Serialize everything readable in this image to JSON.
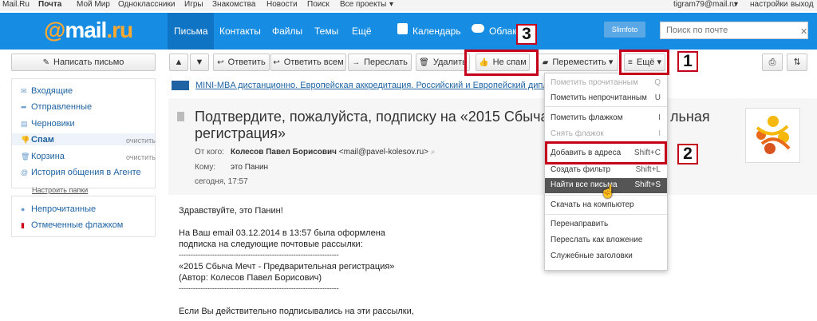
{
  "portal": {
    "links": [
      "Mail.Ru",
      "Почта",
      "Мой Мир",
      "Одноклассники",
      "Игры",
      "Знакомства",
      "Новости",
      "Поиск",
      "Все проекты"
    ],
    "user": "tigram79@mail.ru",
    "settings": "настройки",
    "logout": "выход"
  },
  "header": {
    "logo_at": "@",
    "logo_text": "mail",
    "logo_ru": ".ru",
    "nav": [
      "Письма",
      "Контакты",
      "Файлы",
      "Темы",
      "Ещё"
    ],
    "calendar": "Календарь",
    "cloud": "Облако",
    "slimfoto": "Slimfoto",
    "search_placeholder": "Поиск по почте"
  },
  "toolbar": {
    "compose": "Написать письмо",
    "reply": "Ответить",
    "reply_all": "Ответить всем",
    "forward": "Переслать",
    "delete": "Удалить",
    "not_spam": "Не спам",
    "move": "Переместить",
    "more": "Ещё"
  },
  "sidebar": {
    "items": [
      {
        "label": "Входящие",
        "icon": "inbox-icon"
      },
      {
        "label": "Отправленные",
        "icon": "sent-icon"
      },
      {
        "label": "Черновики",
        "icon": "drafts-icon"
      },
      {
        "label": "Спам",
        "icon": "spam-icon",
        "action": "очистить"
      },
      {
        "label": "Корзина",
        "icon": "trash-icon",
        "action": "очистить"
      },
      {
        "label": "История общения в Агенте",
        "icon": "agent-icon"
      }
    ],
    "setup_folders": "Настроить папки",
    "filters": [
      {
        "label": "Непрочитанные",
        "icon": "unread-dot-icon"
      },
      {
        "label": "Отмеченные флажком",
        "icon": "flag-icon"
      }
    ]
  },
  "message": {
    "ad": "MINI-MBA дистанционно. Европейская аккредитация. Российский и Европейский дипломы",
    "subject": "Подтвердите, пожалуйста, подписку на «2015 Сбыча Мечт - Предварительная регистрация»",
    "subject_line1": "Подтвердите, пожалуйста, подписку на «2015 Сбыча М",
    "subject_tail1": "льная",
    "subject_line2": "регистрация»",
    "from_label": "От кого:",
    "from_name": "Колесов Павел Борисович",
    "from_email": "<mail@pavel-kolesov.ru>",
    "to_label": "Кому:",
    "to_value": "это Панин",
    "date": "сегодня, 17:57",
    "body": [
      "Здравствуйте, это Панин!",
      "",
      "На Ваш email 03.12.2014 в 13:57 была оформлена",
      "подписка на следующие почтовые рассылки:",
      "-------------------------------------------------------------------",
      "«2015 Сбыча Мечт - Предварительная регистрация»",
      "(Автор: Колесов Павел Борисович)",
      "-------------------------------------------------------------------",
      "",
      "Если Вы действительно подписывались на эти рассылки,"
    ]
  },
  "menu": {
    "items": [
      {
        "label": "Пометить прочитанным",
        "key": "Q",
        "disabled": true
      },
      {
        "label": "Пометить непрочитанным",
        "key": "U",
        "disabled": false
      },
      {
        "label": "Пометить флажком",
        "key": "I",
        "disabled": false
      },
      {
        "label": "Снять флажок",
        "key": "I",
        "disabled": true
      },
      {
        "label": "Добавить в адреса",
        "key": "Shift+C",
        "disabled": false
      },
      {
        "label": "Создать фильтр",
        "key": "Shift+L",
        "disabled": false
      },
      {
        "label": "Найти все письма",
        "key": "Shift+S",
        "disabled": false,
        "highlighted": true
      },
      {
        "label": "Скачать на компьютер",
        "key": "",
        "disabled": false
      },
      {
        "label": "Перенаправить",
        "key": "",
        "disabled": false
      },
      {
        "label": "Переслать как вложение",
        "key": "",
        "disabled": false
      },
      {
        "label": "Служебные заголовки",
        "key": "",
        "disabled": false
      }
    ]
  },
  "annotations": [
    "1",
    "2",
    "3"
  ],
  "colors": {
    "header": "#168de2",
    "nav_active": "#0f74c4",
    "logo_accent": "#ffa930",
    "annotation": "#c4001a",
    "link": "#1f63a3"
  }
}
